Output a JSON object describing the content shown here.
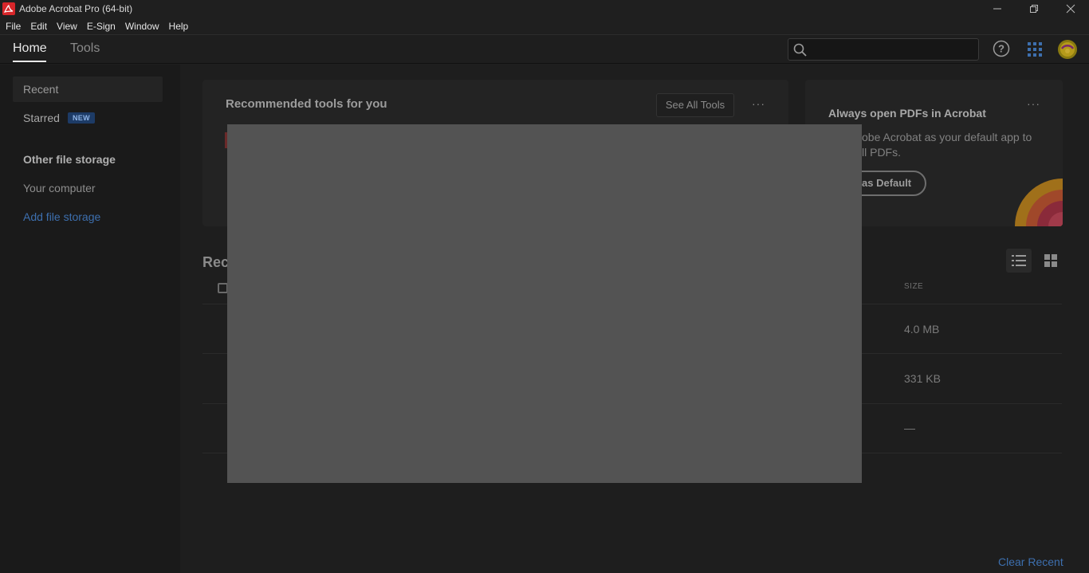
{
  "window": {
    "title": "Adobe Acrobat Pro (64-bit)",
    "controls": [
      "minimize-icon",
      "restore-icon",
      "close-icon"
    ]
  },
  "menu": {
    "items": [
      "File",
      "Edit",
      "View",
      "E-Sign",
      "Window",
      "Help"
    ]
  },
  "header": {
    "tabs": [
      {
        "label": "Home",
        "active": true
      },
      {
        "label": "Tools",
        "active": false
      }
    ],
    "search_placeholder": ""
  },
  "sidebar": {
    "recent": "Recent",
    "starred": "Starred",
    "starred_badge": "NEW",
    "other_storage_heading": "Other file storage",
    "your_computer": "Your computer",
    "add_storage": "Add file storage"
  },
  "recommended": {
    "title": "Recommended tools for you",
    "see_all": "See All Tools",
    "more": "···"
  },
  "default_card": {
    "title": "Always open PDFs in Acrobat",
    "text_line1": "obe Acrobat as your default app to",
    "text_line2": "ll PDFs.",
    "button": "as Default",
    "more": "···"
  },
  "recent": {
    "title": "Rec",
    "column_size": "SIZE",
    "rows": [
      {
        "size": "4.0 MB"
      },
      {
        "size": "331 KB"
      },
      {
        "size": "—"
      }
    ]
  },
  "footer": {
    "clear_recent": "Clear Recent"
  },
  "colors": {
    "accent_link": "#3d6fae",
    "acrobat_red": "#d7262a",
    "modal_gray": "#535353"
  }
}
